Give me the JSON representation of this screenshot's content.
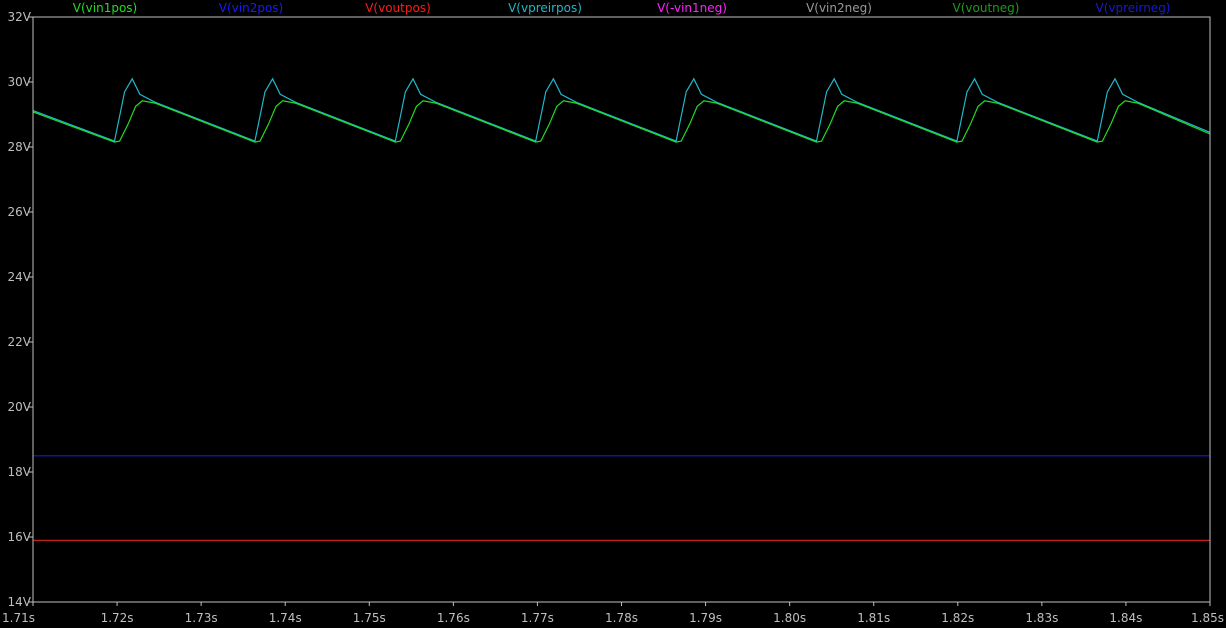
{
  "chart_data": {
    "type": "line",
    "legend": [
      {
        "label": "V(vin1pos)",
        "color": "#22dd22"
      },
      {
        "label": "V(vin2pos)",
        "color": "#1a1aff"
      },
      {
        "label": "V(voutpos)",
        "color": "#ff1a1a"
      },
      {
        "label": "V(vpreirpos)",
        "color": "#20b8c8"
      },
      {
        "label": "V(-vin1neg)",
        "color": "#ff22ff"
      },
      {
        "label": "V(vin2neg)",
        "color": "#999999"
      },
      {
        "label": "V(voutneg)",
        "color": "#1f9a1f"
      },
      {
        "label": "V(vpreirneg)",
        "color": "#1a1acc"
      }
    ],
    "xlim": [
      1.71,
      1.85
    ],
    "ylim": [
      14,
      32
    ],
    "x_ticks": [
      {
        "value": 1.71,
        "label": "1.71s"
      },
      {
        "value": 1.72,
        "label": "1.72s"
      },
      {
        "value": 1.73,
        "label": "1.73s"
      },
      {
        "value": 1.74,
        "label": "1.74s"
      },
      {
        "value": 1.75,
        "label": "1.75s"
      },
      {
        "value": 1.76,
        "label": "1.76s"
      },
      {
        "value": 1.77,
        "label": "1.77s"
      },
      {
        "value": 1.78,
        "label": "1.78s"
      },
      {
        "value": 1.79,
        "label": "1.79s"
      },
      {
        "value": 1.8,
        "label": "1.80s"
      },
      {
        "value": 1.81,
        "label": "1.81s"
      },
      {
        "value": 1.82,
        "label": "1.82s"
      },
      {
        "value": 1.83,
        "label": "1.83s"
      },
      {
        "value": 1.84,
        "label": "1.84s"
      },
      {
        "value": 1.85,
        "label": "1.85s"
      }
    ],
    "y_ticks": [
      {
        "value": 32,
        "label": "32V"
      },
      {
        "value": 30,
        "label": "30V"
      },
      {
        "value": 28,
        "label": "28V"
      },
      {
        "value": 26,
        "label": "26V"
      },
      {
        "value": 24,
        "label": "24V"
      },
      {
        "value": 22,
        "label": "22V"
      },
      {
        "value": 20,
        "label": "20V"
      },
      {
        "value": 18,
        "label": "18V"
      },
      {
        "value": 16,
        "label": "16V"
      },
      {
        "value": 14,
        "label": "14V"
      }
    ],
    "grid": false,
    "series": [
      {
        "color": "#20b8c8",
        "points": [
          [
            1.71,
            29.12
          ],
          [
            1.7197,
            28.18
          ],
          [
            1.7209,
            29.7
          ],
          [
            1.7218,
            30.1
          ],
          [
            1.7227,
            29.62
          ],
          [
            1.7245,
            29.38
          ],
          [
            1.7364,
            28.18
          ],
          [
            1.7376,
            29.7
          ],
          [
            1.7385,
            30.1
          ],
          [
            1.7394,
            29.62
          ],
          [
            1.7412,
            29.38
          ],
          [
            1.7531,
            28.18
          ],
          [
            1.7543,
            29.7
          ],
          [
            1.7552,
            30.1
          ],
          [
            1.7561,
            29.62
          ],
          [
            1.7579,
            29.38
          ],
          [
            1.7698,
            28.18
          ],
          [
            1.771,
            29.7
          ],
          [
            1.7719,
            30.1
          ],
          [
            1.7728,
            29.62
          ],
          [
            1.7746,
            29.38
          ],
          [
            1.7865,
            28.18
          ],
          [
            1.7877,
            29.7
          ],
          [
            1.7886,
            30.1
          ],
          [
            1.7895,
            29.62
          ],
          [
            1.7913,
            29.38
          ],
          [
            1.8032,
            28.18
          ],
          [
            1.8044,
            29.7
          ],
          [
            1.8053,
            30.1
          ],
          [
            1.8062,
            29.62
          ],
          [
            1.808,
            29.38
          ],
          [
            1.8199,
            28.18
          ],
          [
            1.8211,
            29.7
          ],
          [
            1.822,
            30.1
          ],
          [
            1.8229,
            29.62
          ],
          [
            1.8247,
            29.38
          ],
          [
            1.8366,
            28.18
          ],
          [
            1.8378,
            29.7
          ],
          [
            1.8387,
            30.1
          ],
          [
            1.8396,
            29.62
          ],
          [
            1.8414,
            29.38
          ],
          [
            1.85,
            28.45
          ]
        ]
      },
      {
        "color": "#22dd22",
        "points": [
          [
            1.71,
            29.08
          ],
          [
            1.7197,
            28.15
          ],
          [
            1.7203,
            28.18
          ],
          [
            1.7213,
            28.7
          ],
          [
            1.7222,
            29.25
          ],
          [
            1.723,
            29.42
          ],
          [
            1.7245,
            29.35
          ],
          [
            1.7364,
            28.15
          ],
          [
            1.737,
            28.18
          ],
          [
            1.738,
            28.7
          ],
          [
            1.7389,
            29.25
          ],
          [
            1.7397,
            29.42
          ],
          [
            1.7412,
            29.35
          ],
          [
            1.7531,
            28.15
          ],
          [
            1.7537,
            28.18
          ],
          [
            1.7547,
            28.7
          ],
          [
            1.7556,
            29.25
          ],
          [
            1.7564,
            29.42
          ],
          [
            1.7579,
            29.35
          ],
          [
            1.7698,
            28.15
          ],
          [
            1.7704,
            28.18
          ],
          [
            1.7714,
            28.7
          ],
          [
            1.7723,
            29.25
          ],
          [
            1.7731,
            29.42
          ],
          [
            1.7746,
            29.35
          ],
          [
            1.7865,
            28.15
          ],
          [
            1.7871,
            28.18
          ],
          [
            1.7881,
            28.7
          ],
          [
            1.789,
            29.25
          ],
          [
            1.7898,
            29.42
          ],
          [
            1.7913,
            29.35
          ],
          [
            1.8032,
            28.15
          ],
          [
            1.8038,
            28.18
          ],
          [
            1.8048,
            28.7
          ],
          [
            1.8057,
            29.25
          ],
          [
            1.8065,
            29.42
          ],
          [
            1.808,
            29.35
          ],
          [
            1.8199,
            28.15
          ],
          [
            1.8205,
            28.18
          ],
          [
            1.8215,
            28.7
          ],
          [
            1.8224,
            29.25
          ],
          [
            1.8232,
            29.42
          ],
          [
            1.8247,
            29.35
          ],
          [
            1.8366,
            28.15
          ],
          [
            1.8372,
            28.18
          ],
          [
            1.8382,
            28.7
          ],
          [
            1.8391,
            29.25
          ],
          [
            1.8399,
            29.42
          ],
          [
            1.8414,
            29.35
          ],
          [
            1.85,
            28.4
          ]
        ]
      },
      {
        "color": "#1a1acc",
        "points": [
          [
            1.71,
            18.5
          ],
          [
            1.85,
            18.5
          ]
        ]
      },
      {
        "color": "#dd2222",
        "points": [
          [
            1.71,
            15.9
          ],
          [
            1.85,
            15.9
          ]
        ]
      }
    ]
  }
}
